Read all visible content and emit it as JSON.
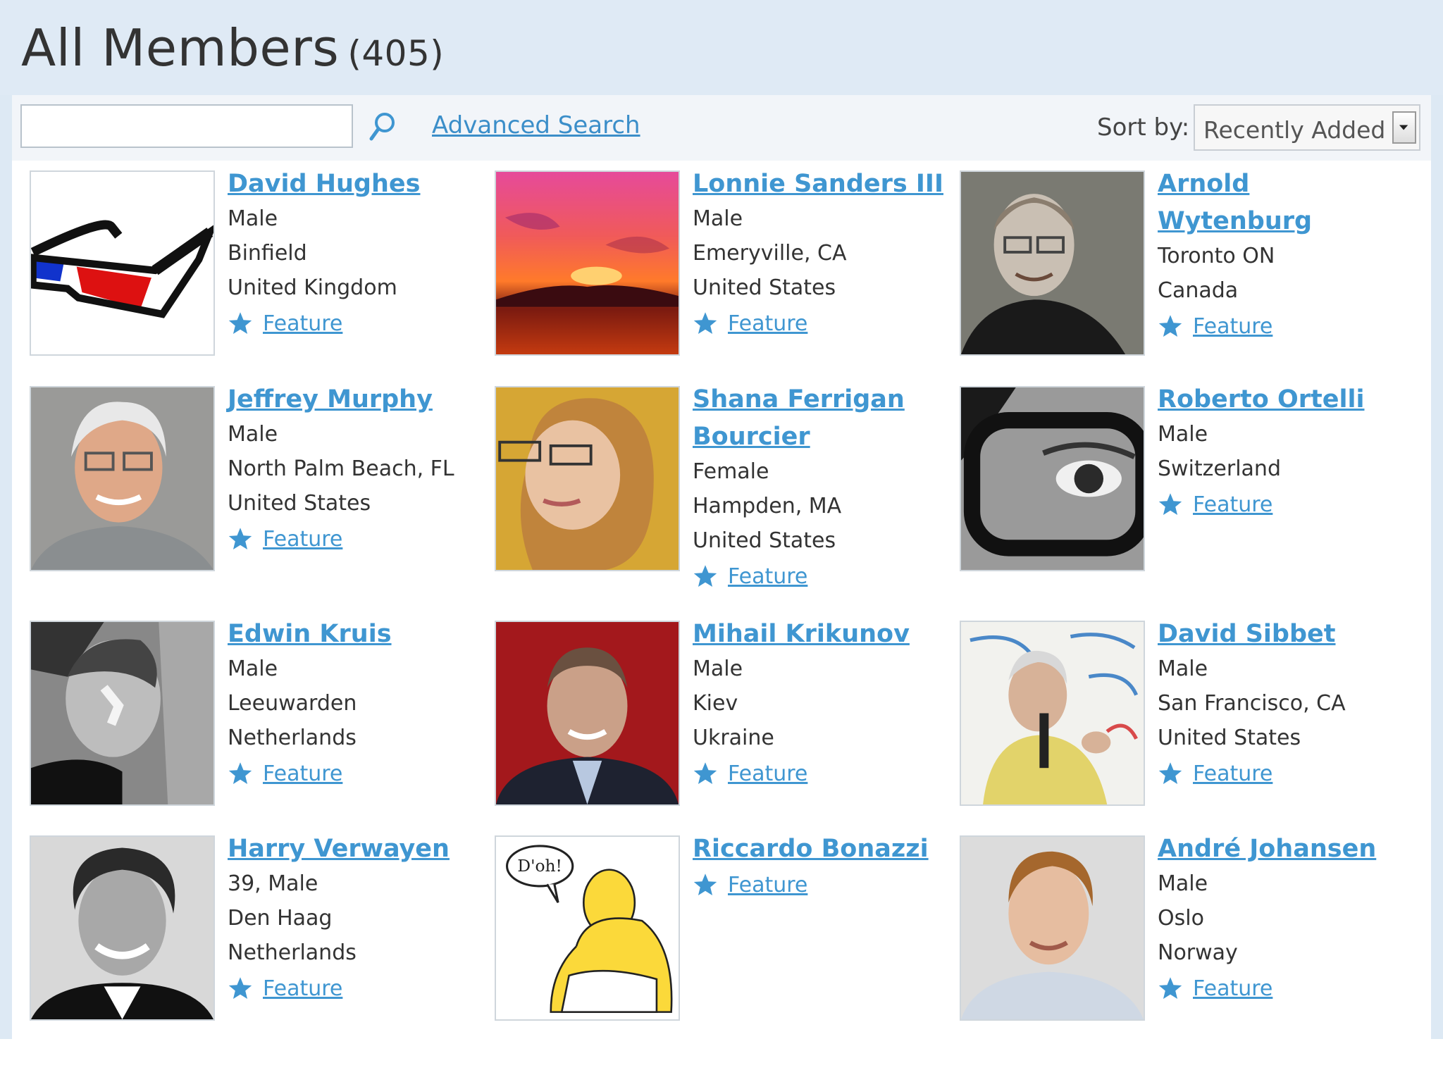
{
  "header": {
    "title": "All Members",
    "count": "(405)"
  },
  "toolbar": {
    "search_value": "",
    "search_placeholder": "",
    "search_icon": "search-icon",
    "advanced_search_label": "Advanced Search",
    "sort_label": "Sort by:",
    "sort_selected": "Recently Added"
  },
  "colors": {
    "link": "#3f96d1",
    "star": "#3f96d1",
    "header_bg": "#dfeaf5"
  },
  "feature_label": "Feature",
  "members": [
    {
      "name": "David Hughes",
      "details": [
        "Male",
        "Binfield",
        "United Kingdom"
      ],
      "photo": "3d-glasses"
    },
    {
      "name": "Lonnie Sanders III",
      "details": [
        "Male",
        "Emeryville, CA",
        "United States"
      ],
      "photo": "sunset"
    },
    {
      "name": "Arnold Wytenburg",
      "details": [
        "Toronto ON",
        "Canada"
      ],
      "photo": "portrait-gray"
    },
    {
      "name": "Jeffrey Murphy",
      "details": [
        "Male",
        "North Palm Beach, FL",
        "United States"
      ],
      "photo": "portrait-gray-hair"
    },
    {
      "name": "Shana Ferrigan Bourcier",
      "details": [
        "Female",
        "Hampden, MA",
        "United States"
      ],
      "photo": "portrait-yellow"
    },
    {
      "name": "Roberto Ortelli",
      "details": [
        "Male",
        "Switzerland"
      ],
      "photo": "eye-closeup"
    },
    {
      "name": "Edwin Kruis",
      "details": [
        "Male",
        "Leeuwarden",
        "Netherlands"
      ],
      "photo": "portrait-bw"
    },
    {
      "name": "Mihail Krikunov",
      "details": [
        "Male",
        "Kiev",
        "Ukraine"
      ],
      "photo": "portrait-red"
    },
    {
      "name": "David Sibbet",
      "details": [
        "Male",
        "San Francisco, CA",
        "United States"
      ],
      "photo": "speaker-whiteboard"
    },
    {
      "name": "Harry Verwayen",
      "details": [
        "39, Male",
        "Den Haag",
        "Netherlands"
      ],
      "photo": "portrait-bw-smile"
    },
    {
      "name": "Riccardo Bonazzi",
      "details": [],
      "photo": "cartoon",
      "photo_caption": "D'oh!"
    },
    {
      "name": "André Johansen",
      "details": [
        "Male",
        "Oslo",
        "Norway"
      ],
      "photo": "portrait-light"
    }
  ]
}
